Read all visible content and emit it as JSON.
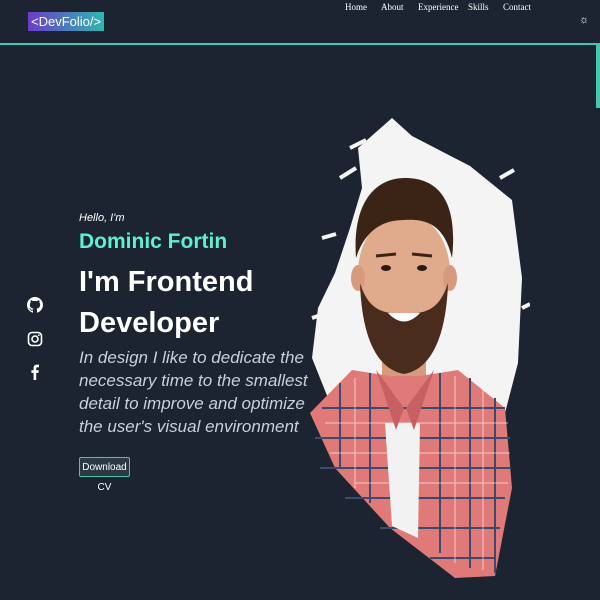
{
  "navbar": {
    "logo": "<DevFolio/>",
    "links": [
      {
        "label": "Home"
      },
      {
        "label": "About"
      },
      {
        "label": "Experience"
      },
      {
        "label": "Skills"
      },
      {
        "label": "Contact"
      }
    ],
    "theme_toggle_icon": "sun-icon"
  },
  "social": [
    {
      "icon": "github-icon"
    },
    {
      "icon": "instagram-icon"
    },
    {
      "icon": "facebook-icon"
    }
  ],
  "hero": {
    "greeting": "Hello, I'm",
    "name": "Dominic Fortin",
    "headline": "I'm Frontend Developer",
    "tagline": "In design I like to dedicate the necessary time to the smallest detail to improve and optimize the user's visual environment",
    "cv_button": "Download CV"
  },
  "colors": {
    "background": "#1b2430",
    "accent": "#5ef0d0",
    "border_accent": "#45c7ad"
  }
}
